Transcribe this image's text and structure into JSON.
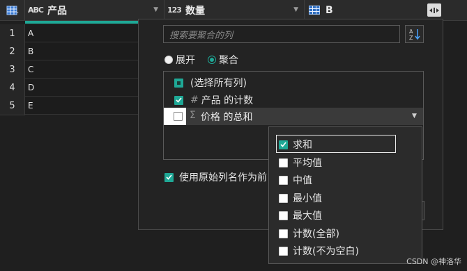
{
  "columns": [
    {
      "type_icon": "table-icon",
      "label": ""
    },
    {
      "type_icon": "text-type-icon",
      "type_glyph": "ABC",
      "label": "产品"
    },
    {
      "type_icon": "number-type-icon",
      "type_glyph": "123",
      "label": "数量"
    },
    {
      "type_icon": "table-type-icon",
      "label": "B"
    }
  ],
  "rows": [
    {
      "num": "1",
      "value": "A"
    },
    {
      "num": "2",
      "value": "B"
    },
    {
      "num": "3",
      "value": "C"
    },
    {
      "num": "4",
      "value": "D"
    },
    {
      "num": "5",
      "value": "E"
    }
  ],
  "panel": {
    "search_placeholder": "搜索要聚合的列",
    "radio_expand": "展开",
    "radio_aggregate": "聚合",
    "selected_mode": "aggregate",
    "list": {
      "select_all": "(选择所有列)",
      "items": [
        {
          "symbol": "#",
          "label": "产品 的计数",
          "checked": true
        },
        {
          "symbol": "Σ",
          "label": "价格 的总和",
          "checked": false
        }
      ]
    },
    "use_original_name_partial": "使用原始列名作为前"
  },
  "dropdown": {
    "items": [
      {
        "label": "求和",
        "checked": true
      },
      {
        "label": "平均值",
        "checked": false
      },
      {
        "label": "中值",
        "checked": false
      },
      {
        "label": "最小值",
        "checked": false
      },
      {
        "label": "最大值",
        "checked": false
      },
      {
        "label": "计数(全部)",
        "checked": false
      },
      {
        "label": "计数(不为空白)",
        "checked": false
      }
    ]
  },
  "watermark": "CSDN @神洛华",
  "colors": {
    "accent": "#1fa896",
    "background": "#1f1f1f",
    "panel": "#232323"
  }
}
